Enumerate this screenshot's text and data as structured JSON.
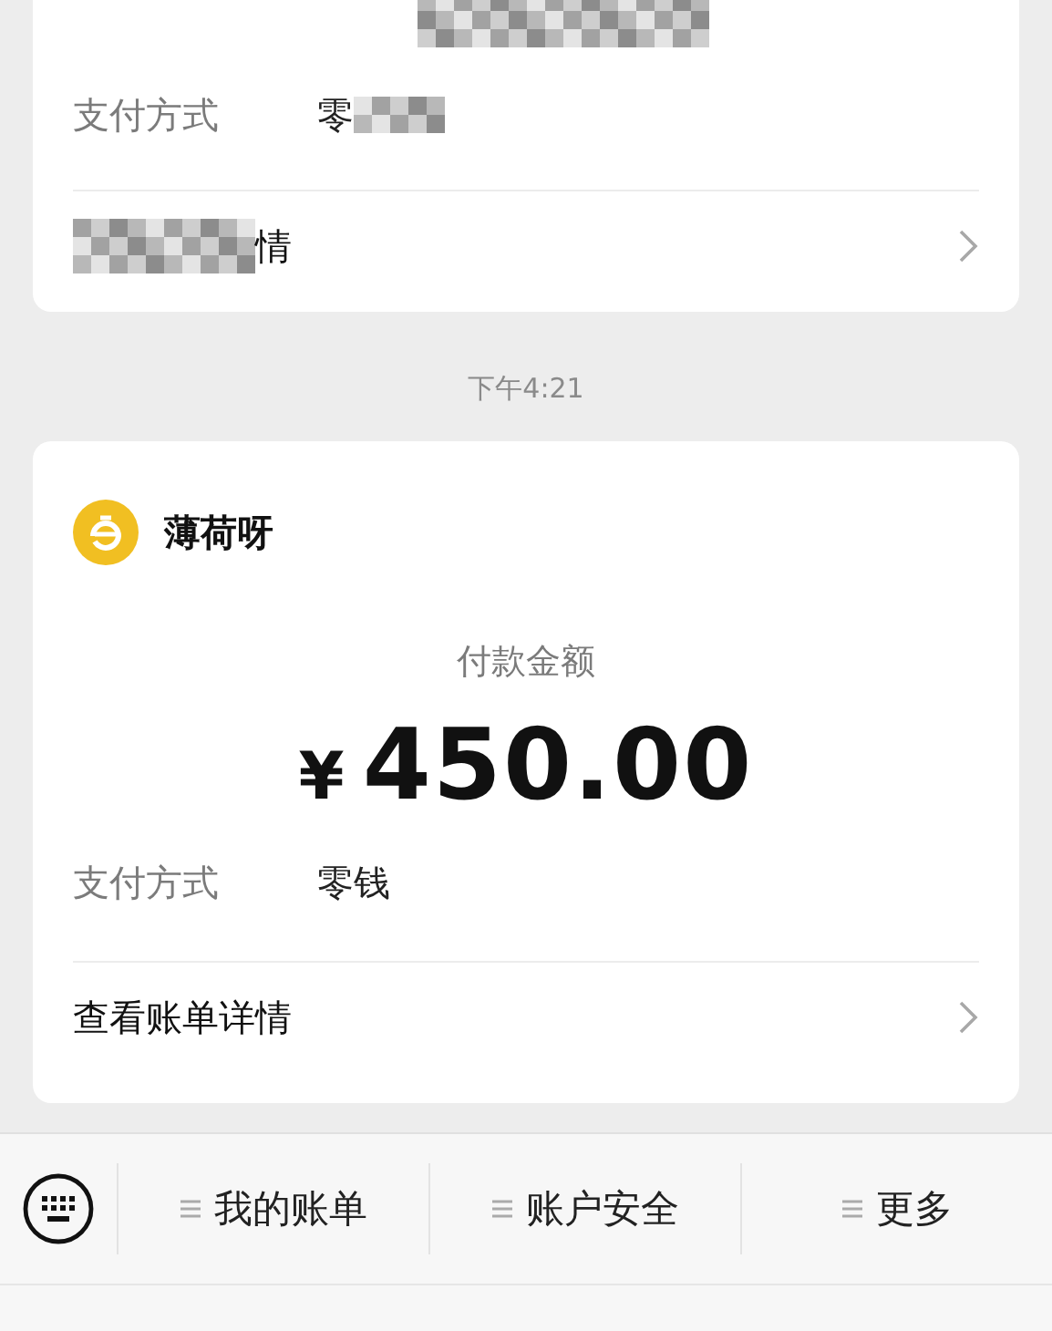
{
  "previous_card": {
    "payment_method_label": "支付方式",
    "payment_method_value": "零",
    "details_link": "情"
  },
  "timestamp": "下午4:21",
  "payment_card": {
    "merchant": "薄荷呀",
    "amount_label": "付款金额",
    "currency": "¥",
    "amount": "450.00",
    "payment_method_label": "支付方式",
    "payment_method_value": "零钱",
    "details_link": "查看账单详情"
  },
  "menu_bar": {
    "items": [
      {
        "label": "我的账单"
      },
      {
        "label": "账户安全"
      },
      {
        "label": "更多"
      }
    ]
  }
}
